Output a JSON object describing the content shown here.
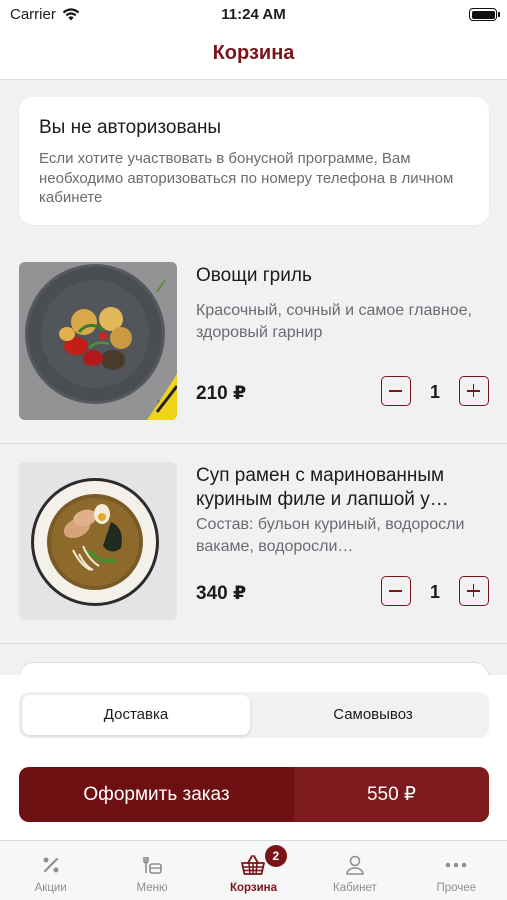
{
  "status_bar": {
    "carrier": "Carrier",
    "time": "11:24 AM"
  },
  "header": {
    "title": "Корзина"
  },
  "auth_notice": {
    "title": "Вы не авторизованы",
    "text": "Если хотите участвовать в бонусной программе, Вам необходимо авторизоваться по номеру телефона в личном кабинете"
  },
  "cart": {
    "items": [
      {
        "name": "Овощи гриль",
        "description": "Красочный, сочный и самое главное, здоровый гарнир",
        "price": "210 ₽",
        "quantity": "1"
      },
      {
        "name": "Суп рамен с маринованным куриным филе и лапшой у…",
        "description": "Состав: бульон куриный, водоросли вакаме, водоросли…",
        "price": "340 ₽",
        "quantity": "1"
      }
    ]
  },
  "delivery": {
    "options": [
      "Доставка",
      "Самовывоз"
    ],
    "selected": "Доставка"
  },
  "checkout": {
    "label": "Оформить заказ",
    "total": "550 ₽"
  },
  "tab_bar": {
    "tabs": [
      {
        "label": "Акции",
        "icon": "percent-icon"
      },
      {
        "label": "Меню",
        "icon": "menu-icon"
      },
      {
        "label": "Корзина",
        "icon": "basket-icon",
        "badge": "2",
        "active": true
      },
      {
        "label": "Кабинет",
        "icon": "profile-icon"
      },
      {
        "label": "Прочее",
        "icon": "more-icon"
      }
    ]
  },
  "colors": {
    "accent": "#7a1418",
    "button": "#6e0f12",
    "background": "#f1f1f3"
  }
}
